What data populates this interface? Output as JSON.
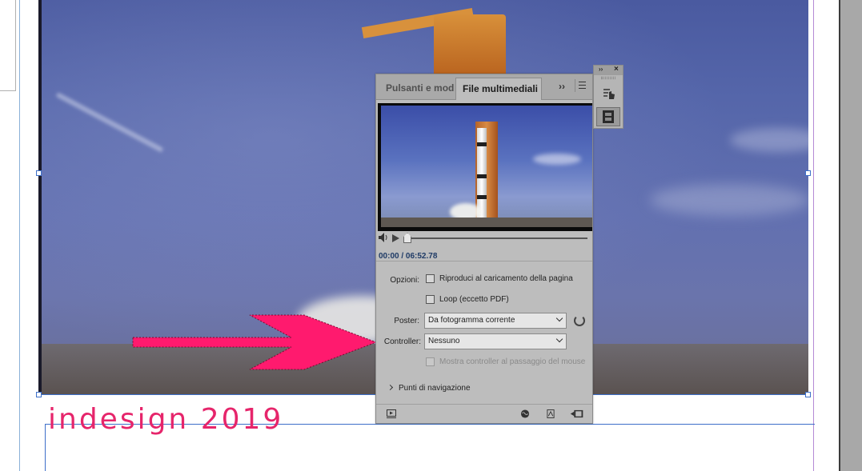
{
  "document": {
    "caption": "indesign 2019"
  },
  "panel": {
    "tabs": [
      {
        "label": "Pulsanti e modu",
        "active": false
      },
      {
        "label": "File multimediali",
        "active": true
      }
    ],
    "more_label": "››",
    "timecode": "00:00 / 06:52.78",
    "options_label": "Opzioni:",
    "autoplay_label": "Riproduci al caricamento della pagina",
    "loop_label": "Loop (eccetto PDF)",
    "poster_label": "Poster:",
    "poster_value": "Da fotogramma corrente",
    "controller_label": "Controller:",
    "controller_value": "Nessuno",
    "mouseover_label": "Mostra controller al passaggio del mouse",
    "nav_points_label": "Punti di navigazione",
    "autoplay_checked": false,
    "loop_checked": false,
    "mouseover_checked": false,
    "mouseover_enabled": false,
    "playhead_position": 0
  },
  "side_panel": {
    "collapse_label": "››",
    "close_label": "×"
  },
  "colors": {
    "caption": "#e6256b",
    "arrow": "#ff1a6e",
    "panel_bg": "#bdbdbd",
    "timecode": "#1f3b66"
  }
}
